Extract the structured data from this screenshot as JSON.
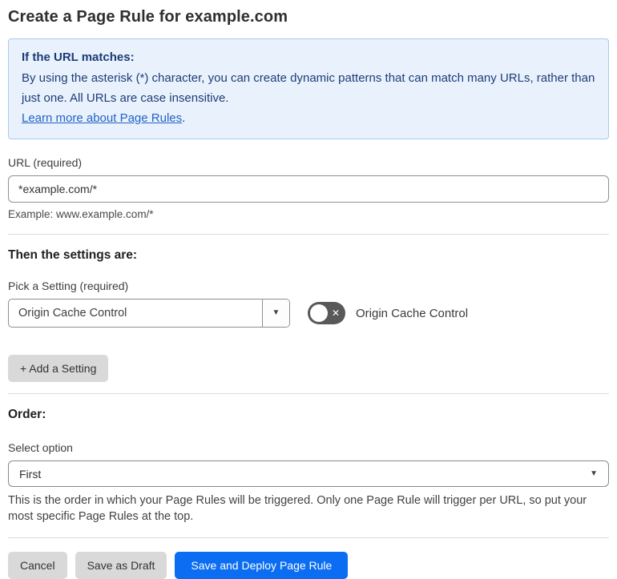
{
  "page": {
    "title": "Create a Page Rule for example.com"
  },
  "info_box": {
    "heading": "If the URL matches:",
    "body": "By using the asterisk (*) character, you can create dynamic patterns that can match many URLs, rather than just one. All URLs are case insensitive.",
    "link_label": "Learn more about Page Rules",
    "link_suffix": "."
  },
  "url_field": {
    "label": "URL (required)",
    "value": "*example.com/*",
    "hint": "Example: www.example.com/*"
  },
  "settings_section": {
    "heading": "Then the settings are:",
    "setting_label": "Pick a Setting (required)",
    "setting_value": "Origin Cache Control",
    "dropdown_arrow_icon": "▼",
    "toggle_state": "off",
    "toggle_off_icon": "✕",
    "toggle_label": "Origin Cache Control",
    "add_button_label": "+ Add a Setting"
  },
  "order_section": {
    "heading": "Order:",
    "select_label": "Select option",
    "select_value": "First",
    "dropdown_arrow_icon": "▼",
    "help_text": "This is the order in which your Page Rules will be triggered. Only one Page Rule will trigger per URL, so put your most specific Page Rules at the top."
  },
  "footer": {
    "cancel_label": "Cancel",
    "save_draft_label": "Save as Draft",
    "save_deploy_label": "Save and Deploy Page Rule"
  },
  "colors": {
    "accent_blue": "#0b6df2",
    "info_box_bg": "#e9f2fc",
    "info_box_border": "#a9c9ec",
    "info_text": "#1d3c78",
    "link_blue": "#2262c9",
    "toggle_off_bg": "#595959",
    "button_gray": "#d9d9d9"
  }
}
